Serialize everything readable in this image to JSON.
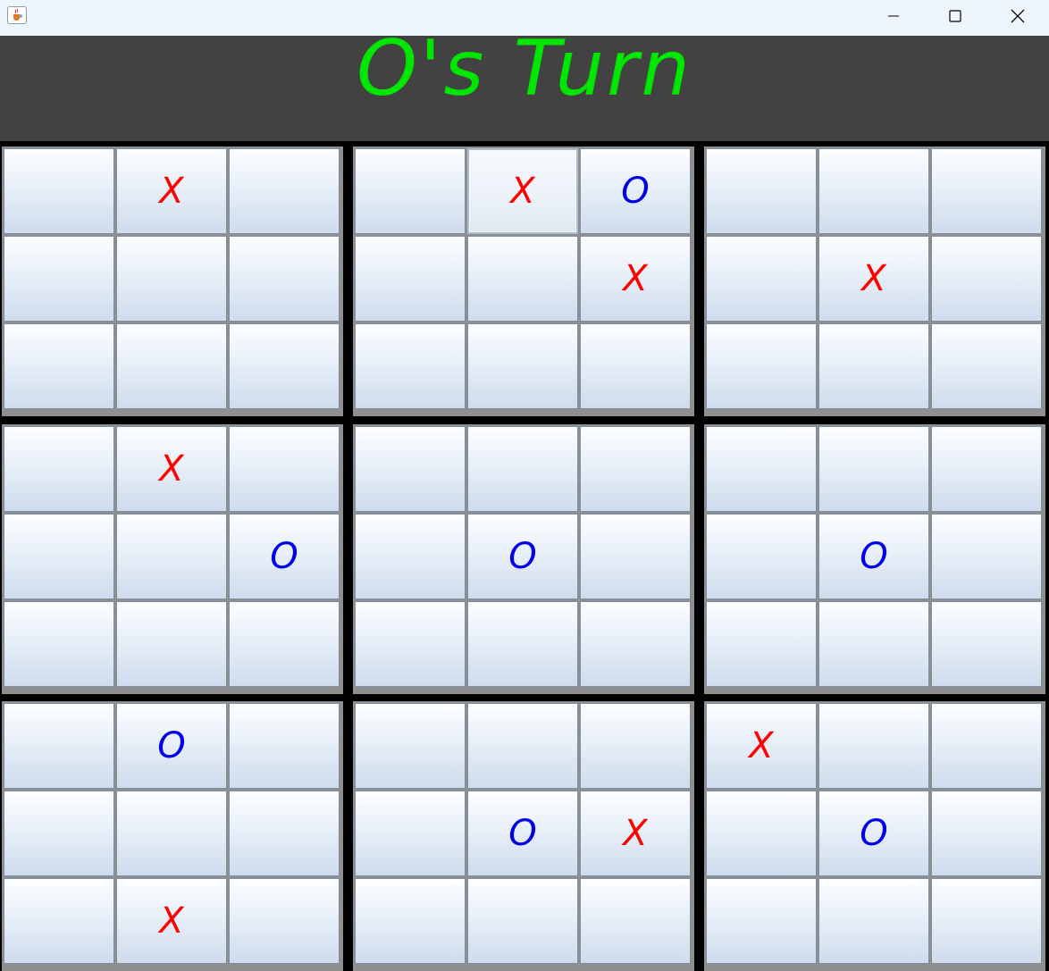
{
  "window": {
    "app_icon": "java-cup-icon",
    "minimize_icon": "minimize-icon",
    "maximize_icon": "maximize-icon",
    "close_icon": "close-icon"
  },
  "header": {
    "turn_text": "O's Turn",
    "turn_color": "#00e600",
    "background": "#424242"
  },
  "colors": {
    "x_mark": "#ff0000",
    "o_mark": "#0000e6"
  },
  "boards": [
    [
      "",
      "X",
      "",
      "",
      "",
      "",
      "",
      "",
      ""
    ],
    [
      "",
      "X",
      "O",
      "",
      "",
      "X",
      "",
      "",
      ""
    ],
    [
      "",
      "",
      "",
      "",
      "X",
      "",
      "",
      "",
      ""
    ],
    [
      "",
      "X",
      "",
      "",
      "",
      "O",
      "",
      "",
      ""
    ],
    [
      "",
      "",
      "",
      "",
      "O",
      "",
      "",
      "",
      ""
    ],
    [
      "",
      "",
      "",
      "",
      "O",
      "",
      "",
      "",
      ""
    ],
    [
      "",
      "O",
      "",
      "",
      "",
      "",
      "",
      "X",
      ""
    ],
    [
      "",
      "",
      "",
      "",
      "O",
      "X",
      "",
      "",
      ""
    ],
    [
      "X",
      "",
      "",
      "",
      "O",
      "",
      "",
      "",
      ""
    ]
  ]
}
